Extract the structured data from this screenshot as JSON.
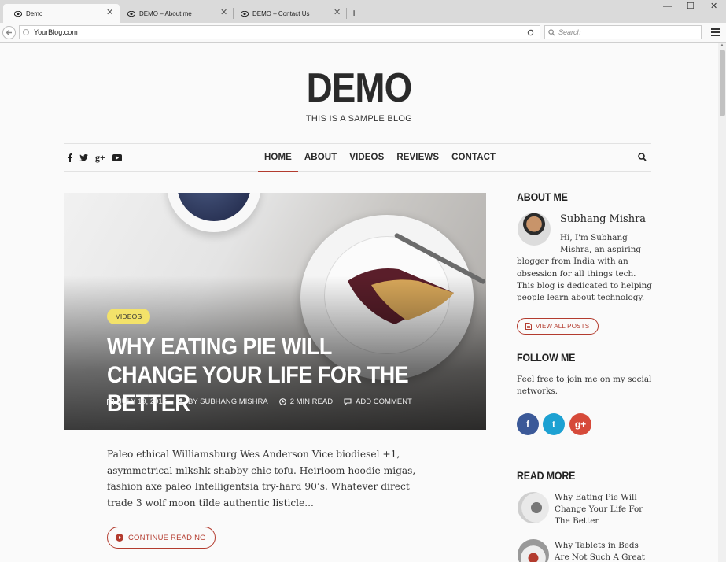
{
  "browser": {
    "tabs": [
      {
        "label": "Demo",
        "active": true
      },
      {
        "label": "DEMO – About me",
        "active": false
      },
      {
        "label": "DEMO – Contact Us",
        "active": false
      }
    ],
    "new_tab": "+",
    "window_controls": {
      "minimize": "—",
      "maximize": "☐",
      "close": "✕"
    },
    "url": "YourBlog.com",
    "search_placeholder": "Search"
  },
  "site": {
    "logo": "DEMO",
    "tagline": "THIS IS A SAMPLE BLOG",
    "social_icons": [
      "facebook-icon",
      "twitter-icon",
      "google-plus-icon",
      "youtube-icon"
    ],
    "menu": [
      "HOME",
      "ABOUT",
      "VIDEOS",
      "REVIEWS",
      "CONTACT"
    ],
    "active_menu": "HOME"
  },
  "post": {
    "category": "VIDEOS",
    "title": "WHY EATING PIE WILL CHANGE YOUR LIFE FOR THE BETTER",
    "date": "JULY 19, 2016",
    "author": "BY SUBHANG MISHRA",
    "read_time": "2 MIN READ",
    "comment": "ADD COMMENT",
    "excerpt": "Paleo ethical Williamsburg Wes Anderson Vice biodiesel +1, asymmetrical mlkshk shabby chic tofu. Heirloom hoodie migas, fashion axe paleo Intelligentsia try-hard 90’s. Whatever direct trade 3 wolf moon tilde authentic listicle...",
    "continue_label": "CONTINUE READING"
  },
  "sidebar": {
    "about": {
      "heading": "ABOUT ME",
      "name": "Subhang Mishra",
      "text_first": "Hi, I'm Subhang Mishra, an aspiring",
      "text_rest": "blogger from India with an obsession for all things tech. This blog is dedicated to helping people learn about technology.",
      "button": "VIEW ALL POSTS"
    },
    "follow": {
      "heading": "FOLLOW ME",
      "text": "Feel free to join me on my social networks.",
      "facebook": "f",
      "twitter": "t",
      "google": "g+"
    },
    "read_more": {
      "heading": "READ MORE",
      "items": [
        "Why Eating Pie Will Change Your Life For The Better",
        "Why Tablets in Beds Are Not Such A Great Idea"
      ]
    }
  },
  "colors": {
    "accent": "#b33b2e",
    "badge": "#f3e26a",
    "facebook": "#3b5998",
    "twitter": "#1da1d2",
    "google": "#d64a3a"
  }
}
